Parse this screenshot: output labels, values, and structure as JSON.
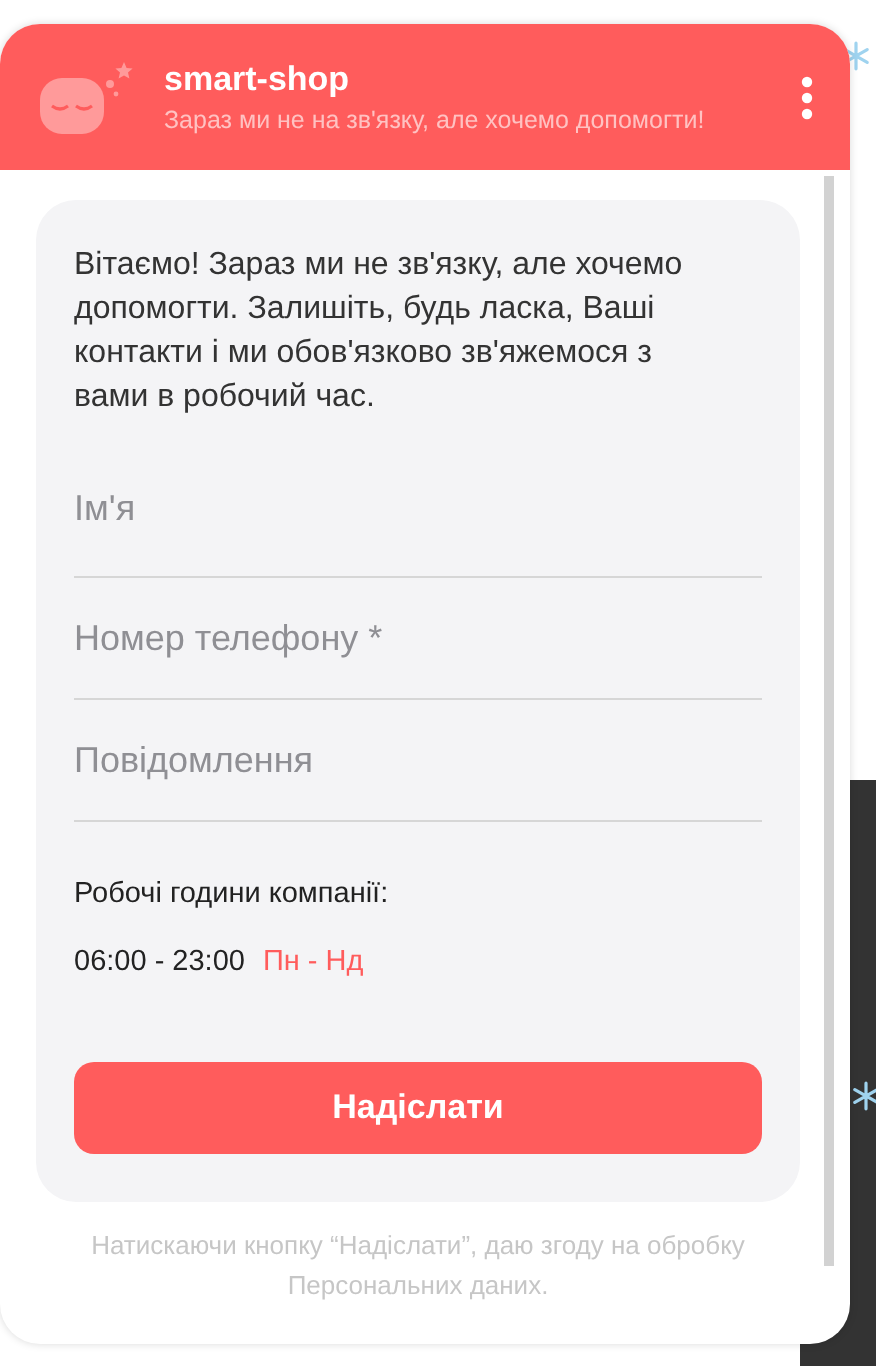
{
  "header": {
    "title": "smart-shop",
    "subtitle": "Зараз ми не на зв'язку, але хочемо допомогти!"
  },
  "form": {
    "intro": "Вітаємо! Зараз ми не зв'язку, але хочемо допомогти. Залишіть, будь ласка, Ваші контакти і ми обов'язково зв'яжемося з вами в робочий час.",
    "fields": [
      {
        "placeholder": "Ім'я"
      },
      {
        "placeholder": "Номер телефону *"
      },
      {
        "placeholder": "Повідомлення"
      }
    ],
    "hours_label": "Робочі години компанії:",
    "hours_time": "06:00 - 23:00",
    "hours_days": "Пн - Нд",
    "submit": "Надіслати"
  },
  "consent": "Натискаючи кнопку “Надіслати”, даю згоду на обробку Персональних даних."
}
